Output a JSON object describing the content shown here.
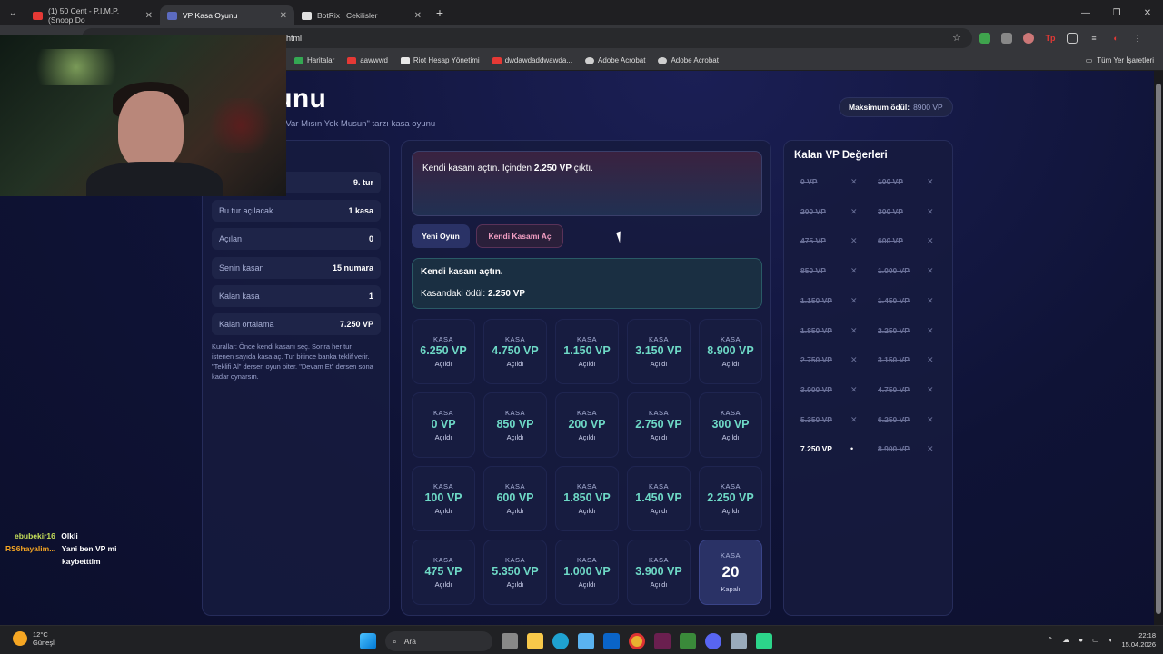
{
  "browser": {
    "tabs": [
      {
        "title": "(1) 50 Cent - P.I.M.P. (Snoop Do",
        "favicon_color": "#e53935"
      },
      {
        "title": "VP Kasa Oyunu",
        "favicon_color": "#5c6bc0"
      },
      {
        "title": "BotRix | Cekilisler",
        "favicon_color": "#e0e0e0"
      }
    ],
    "url": "html",
    "bookmarks": [
      {
        "label": "Haritalar",
        "color": "#34a853"
      },
      {
        "label": "aawwwd",
        "color": "#e53935"
      },
      {
        "label": "Riot Hesap Yönetimi",
        "color": "#e8e8e8"
      },
      {
        "label": "dwdawdaddwawda...",
        "color": "#e53935"
      },
      {
        "label": "Adobe Acrobat",
        "color": "#cfcfcf"
      },
      {
        "label": "Adobe Acrobat",
        "color": "#cfcfcf"
      }
    ],
    "all_bookmarks": "Tüm Yer İşaretleri"
  },
  "header": {
    "title": "sa Oyunu",
    "subtitle": "n, Valorant VP ödüllü \"Var Mısın Yok Musun\" tarzı kasa oyunu",
    "max_prize_label": "Maksimum ödül:",
    "max_prize_value": "8900 VP"
  },
  "stats": [
    {
      "key": "",
      "value": "9. tur"
    },
    {
      "key": "Bu tur açılacak",
      "value": "1 kasa"
    },
    {
      "key": "Açılan",
      "value": "0"
    },
    {
      "key": "Senin kasan",
      "value": "15 numara"
    },
    {
      "key": "Kalan kasa",
      "value": "1"
    },
    {
      "key": "Kalan ortalama",
      "value": "7.250 VP"
    }
  ],
  "rules": "Kurallar: Önce kendi kasanı seç. Sonra her tur istenen sayıda kasa aç. Tur bitince banka teklif verir. \"Teklifi Al\" dersen oyun biter. \"Devam Et\" dersen sona kadar oynarsın.",
  "message": {
    "prefix": "Kendi kasanı açtın. İçinden ",
    "amount": "2.250 VP",
    "suffix": " çıktı."
  },
  "buttons": {
    "new_game": "Yeni Oyun",
    "open_own": "Kendi Kasamı Aç"
  },
  "info": {
    "line1": "Kendi kasanı açtın.",
    "line2_label": "Kasandaki ödül: ",
    "line2_value": "2.250 VP"
  },
  "boxes": [
    {
      "label": "KASA",
      "value": "6.250 VP",
      "status": "Açıldı"
    },
    {
      "label": "KASA",
      "value": "4.750 VP",
      "status": "Açıldı"
    },
    {
      "label": "KASA",
      "value": "1.150 VP",
      "status": "Açıldı"
    },
    {
      "label": "KASA",
      "value": "3.150 VP",
      "status": "Açıldı"
    },
    {
      "label": "KASA",
      "value": "8.900 VP",
      "status": "Açıldı"
    },
    {
      "label": "KASA",
      "value": "0 VP",
      "status": "Açıldı"
    },
    {
      "label": "KASA",
      "value": "850 VP",
      "status": "Açıldı"
    },
    {
      "label": "KASA",
      "value": "200 VP",
      "status": "Açıldı"
    },
    {
      "label": "KASA",
      "value": "2.750 VP",
      "status": "Açıldı"
    },
    {
      "label": "KASA",
      "value": "300 VP",
      "status": "Açıldı"
    },
    {
      "label": "KASA",
      "value": "100 VP",
      "status": "Açıldı"
    },
    {
      "label": "KASA",
      "value": "600 VP",
      "status": "Açıldı"
    },
    {
      "label": "KASA",
      "value": "1.850 VP",
      "status": "Açıldı"
    },
    {
      "label": "KASA",
      "value": "1.450 VP",
      "status": "Açıldı"
    },
    {
      "label": "KASA",
      "value": "2.250 VP",
      "status": "Açıldı"
    },
    {
      "label": "KASA",
      "value": "475 VP",
      "status": "Açıldı"
    },
    {
      "label": "KASA",
      "value": "5.350 VP",
      "status": "Açıldı"
    },
    {
      "label": "KASA",
      "value": "1.000 VP",
      "status": "Açıldı"
    },
    {
      "label": "KASA",
      "value": "3.900 VP",
      "status": "Açıldı"
    },
    {
      "label": "KASA",
      "number": "20",
      "status": "Kapalı",
      "closed": true
    }
  ],
  "remaining": {
    "title": "Kalan VP Değerleri",
    "values": [
      {
        "value": "0 VP",
        "mark": "✕",
        "live": false
      },
      {
        "value": "100 VP",
        "mark": "✕",
        "live": false
      },
      {
        "value": "200 VP",
        "mark": "✕",
        "live": false
      },
      {
        "value": "300 VP",
        "mark": "✕",
        "live": false
      },
      {
        "value": "475 VP",
        "mark": "✕",
        "live": false
      },
      {
        "value": "600 VP",
        "mark": "✕",
        "live": false
      },
      {
        "value": "850 VP",
        "mark": "✕",
        "live": false
      },
      {
        "value": "1.000 VP",
        "mark": "✕",
        "live": false
      },
      {
        "value": "1.150 VP",
        "mark": "✕",
        "live": false
      },
      {
        "value": "1.450 VP",
        "mark": "✕",
        "live": false
      },
      {
        "value": "1.850 VP",
        "mark": "✕",
        "live": false
      },
      {
        "value": "2.250 VP",
        "mark": "✕",
        "live": false
      },
      {
        "value": "2.750 VP",
        "mark": "✕",
        "live": false
      },
      {
        "value": "3.150 VP",
        "mark": "✕",
        "live": false
      },
      {
        "value": "3.900 VP",
        "mark": "✕",
        "live": false
      },
      {
        "value": "4.750 VP",
        "mark": "✕",
        "live": false
      },
      {
        "value": "5.350 VP",
        "mark": "✕",
        "live": false
      },
      {
        "value": "6.250 VP",
        "mark": "✕",
        "live": false
      },
      {
        "value": "7.250 VP",
        "mark": "•",
        "live": true
      },
      {
        "value": "8.900 VP",
        "mark": "✕",
        "live": false
      }
    ]
  },
  "chat": [
    {
      "user": "ebubekir16",
      "user_color": "#c6e05a",
      "text": "Olkli"
    },
    {
      "user": "RS6hayalim...",
      "user_color": "#f5a623",
      "text": "Yani ben VP mi"
    },
    {
      "user": "",
      "user_color": "#ffffff",
      "text": "kaybetttim"
    }
  ],
  "taskbar": {
    "temp": "12°C",
    "weather": "Güneşli",
    "search": "Ara",
    "time": "22:18",
    "date": "15.04.2026"
  }
}
